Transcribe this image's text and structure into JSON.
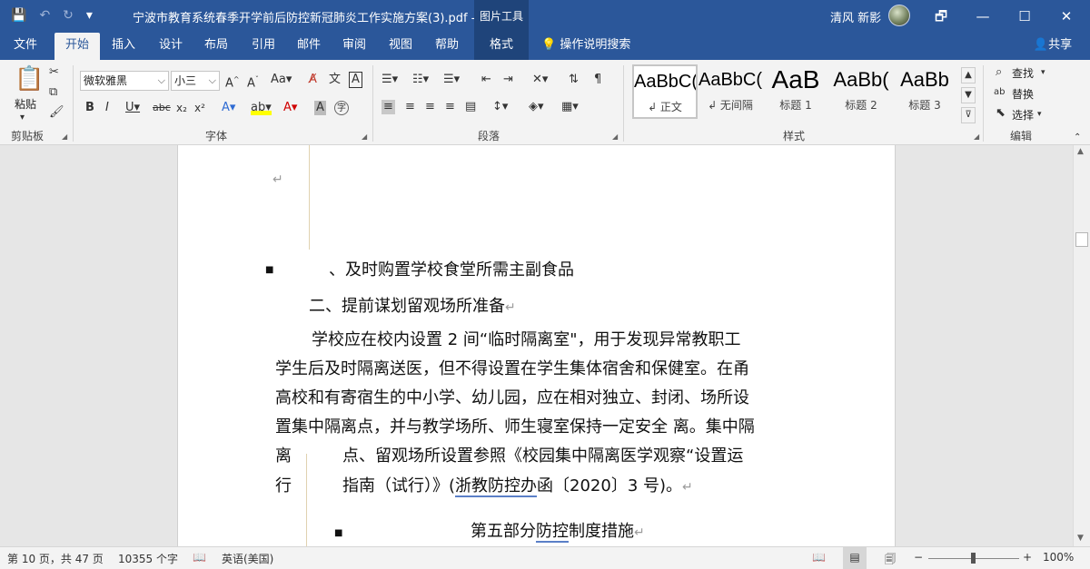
{
  "titlebar": {
    "title": "宁波市教育系统春季开学前后防控新冠肺炎工作实施方案(3).pdf  -...",
    "picture_tools": "图片工具",
    "user": "清风 新影",
    "qat": {
      "save": "💾",
      "undo": "↶",
      "redo": "↻",
      "customize": "▾"
    },
    "win": {
      "restore": "🗗",
      "minimize": "—",
      "maximize": "☐",
      "close": "✕"
    }
  },
  "tabs": [
    "文件",
    "开始",
    "插入",
    "设计",
    "布局",
    "引用",
    "邮件",
    "审阅",
    "视图",
    "帮助",
    "格式"
  ],
  "tell_me": "操作说明搜索",
  "share": "共享",
  "ribbon": {
    "clipboard": {
      "label": "剪贴板",
      "paste": "粘贴"
    },
    "font": {
      "label": "字体",
      "name": "微软雅黑",
      "size": "小三"
    },
    "paragraph": {
      "label": "段落"
    },
    "styles": {
      "label": "样式",
      "items": [
        {
          "sample": "AaBbC(",
          "name": "↲ 正文"
        },
        {
          "sample": "AaBbC(",
          "name": "↲ 无间隔"
        },
        {
          "sample": "AaB",
          "name": "标题 1"
        },
        {
          "sample": "AaBb(",
          "name": "标题 2"
        },
        {
          "sample": "AaBb",
          "name": "标题 3"
        }
      ]
    },
    "editing": {
      "label": "编辑",
      "find": "查找",
      "replace": "替换",
      "select": "选择"
    }
  },
  "document": {
    "empty_mark": "↵",
    "line1": "、及时购置学校食堂所需主副食品",
    "heading2": "二、提前谋划留观场所准备",
    "para": [
      "学校应在校内设置 2 间“临时隔离室\"，用于发现异常教职工",
      "学生后及时隔离送医，但不得设置在学生集体宿舍和保健室。在甬",
      "高校和有寄宿生的中小学、幼儿园，应在相对独立、封闭、场所设",
      "置集中隔离点，并与教学场所、师生寝室保持一定安全 离。集中隔"
    ],
    "side_char1": "离",
    "side_char2": "行",
    "para_tail1": "点、留观场所设置参照《校园集中隔离医学观察“设置运",
    "para_tail2_a": "指南（试行）》(",
    "para_tail2_b": "浙教防控办",
    "para_tail2_c": "函〔2020〕3 号)。",
    "section_a": "第五部分",
    "section_b": "防控",
    "section_c": "制度措施",
    "mark": "↵"
  },
  "status": {
    "page": "第 10 页，共 47 页",
    "words": "10355 个字",
    "lang": "英语(美国)",
    "zoom": "100%"
  }
}
